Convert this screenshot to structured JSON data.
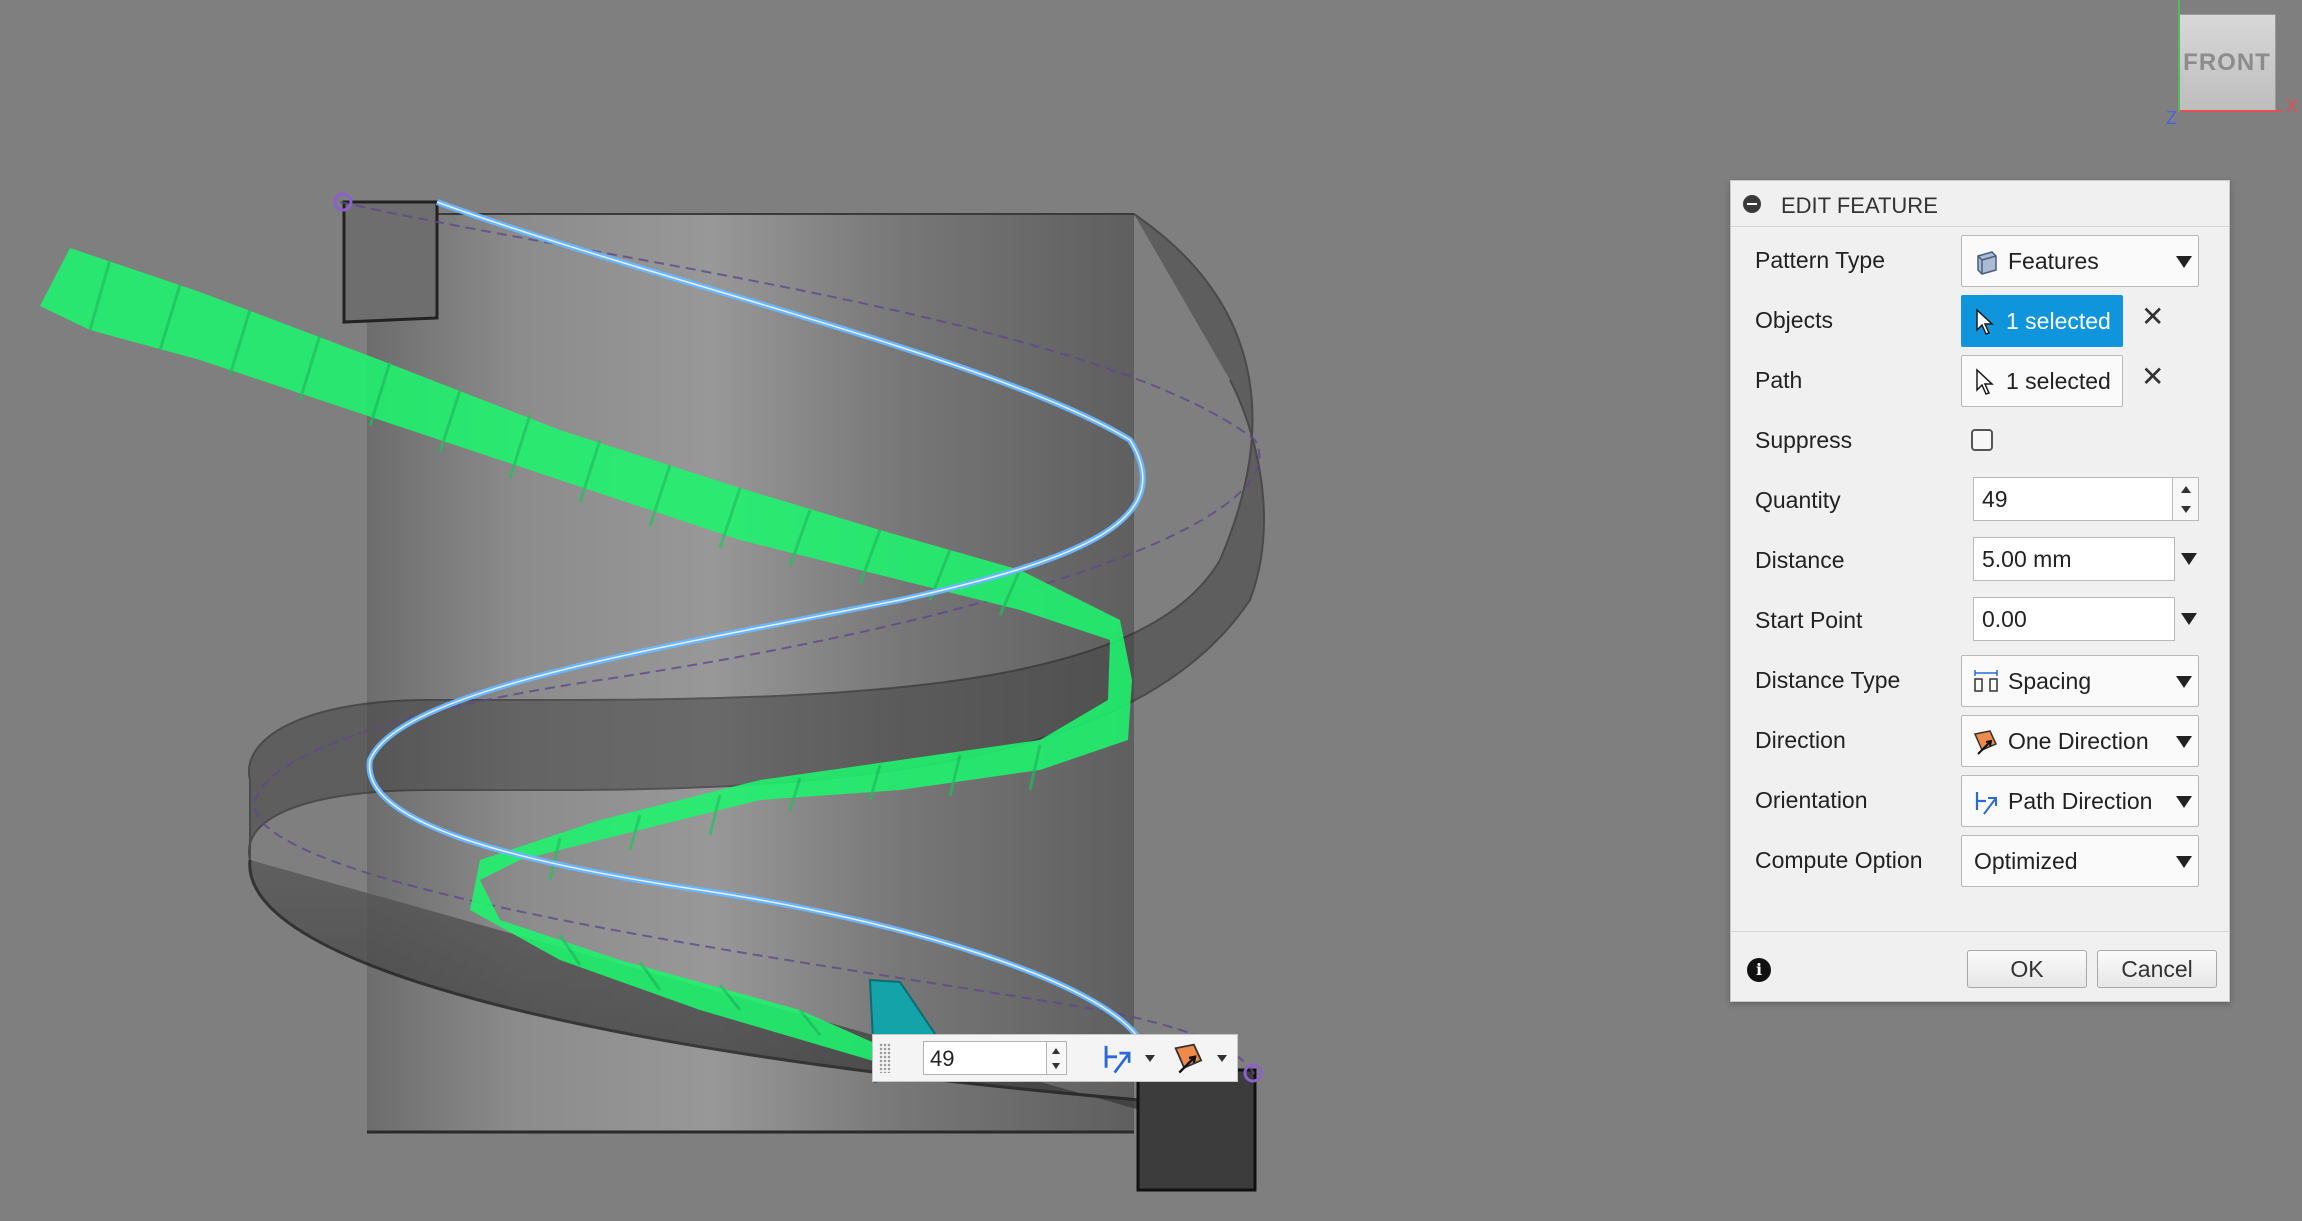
{
  "viewcube": {
    "face_label": "FRONT",
    "axis_x": "X",
    "axis_z": "Z"
  },
  "panel": {
    "title": "EDIT FEATURE",
    "rows": {
      "pattern_type": {
        "label": "Pattern Type",
        "value": "Features",
        "icon": "features-icon"
      },
      "objects": {
        "label": "Objects",
        "value": "1 selected",
        "active": true
      },
      "path": {
        "label": "Path",
        "value": "1 selected",
        "active": false
      },
      "suppress": {
        "label": "Suppress",
        "checked": false
      },
      "quantity": {
        "label": "Quantity",
        "value": "49"
      },
      "distance": {
        "label": "Distance",
        "value": "5.00 mm"
      },
      "start_point": {
        "label": "Start Point",
        "value": "0.00"
      },
      "distance_type": {
        "label": "Distance Type",
        "value": "Spacing",
        "icon": "spacing-icon"
      },
      "direction": {
        "label": "Direction",
        "value": "One Direction",
        "icon": "one-direction-icon"
      },
      "orientation": {
        "label": "Orientation",
        "value": "Path Direction",
        "icon": "path-direction-icon"
      },
      "compute_option": {
        "label": "Compute Option",
        "value": "Optimized"
      }
    },
    "ok_label": "OK",
    "cancel_label": "Cancel"
  },
  "mini_toolbar": {
    "quantity": "49"
  },
  "colors": {
    "canvas_bg": "#7f7f7f",
    "pattern_green": "#1ef56e",
    "selection_blue": "#0f95dc",
    "path_highlight": "#6ab7ff",
    "handle_purple": "#8a62c9"
  }
}
